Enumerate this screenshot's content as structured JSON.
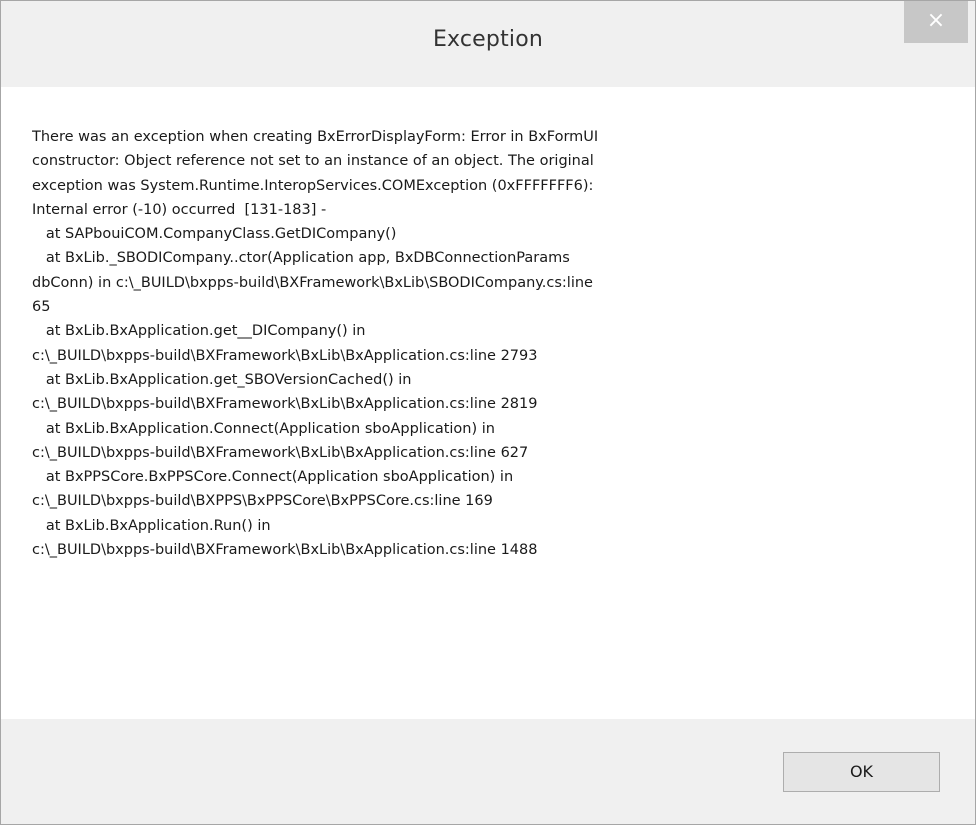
{
  "dialog": {
    "title": "Exception",
    "close_symbol": "×",
    "message_lines": [
      "There was an exception when creating BxErrorDisplayForm: Error in BxFormUI",
      "constructor: Object reference not set to an instance of an object. The original",
      "exception was System.Runtime.InteropServices.COMException (0xFFFFFFF6):",
      "Internal error (-10) occurred  [131-183] -",
      "   at SAPbouiCOM.CompanyClass.GetDICompany()",
      "   at BxLib._SBODICompany..ctor(Application app, BxDBConnectionParams",
      "dbConn) in c:\\_BUILD\\bxpps-build\\BXFramework\\BxLib\\SBODICompany.cs:line",
      "65",
      "   at BxLib.BxApplication.get__DICompany() in",
      "c:\\_BUILD\\bxpps-build\\BXFramework\\BxLib\\BxApplication.cs:line 2793",
      "   at BxLib.BxApplication.get_SBOVersionCached() in",
      "c:\\_BUILD\\bxpps-build\\BXFramework\\BxLib\\BxApplication.cs:line 2819",
      "   at BxLib.BxApplication.Connect(Application sboApplication) in",
      "c:\\_BUILD\\bxpps-build\\BXFramework\\BxLib\\BxApplication.cs:line 627",
      "   at BxPPSCore.BxPPSCore.Connect(Application sboApplication) in",
      "c:\\_BUILD\\bxpps-build\\BXPPS\\BxPPSCore\\BxPPSCore.cs:line 169",
      "   at BxLib.BxApplication.Run() in",
      "c:\\_BUILD\\bxpps-build\\BXFramework\\BxLib\\BxApplication.cs:line 1488"
    ],
    "ok_label": "OK"
  },
  "colors": {
    "frame_background": "#f0f0f0",
    "content_background": "#ffffff",
    "close_button_background": "#c7c7c7",
    "ok_button_background": "#e5e5e5",
    "ok_button_border": "#adadad",
    "text": "#1a1a1a"
  }
}
